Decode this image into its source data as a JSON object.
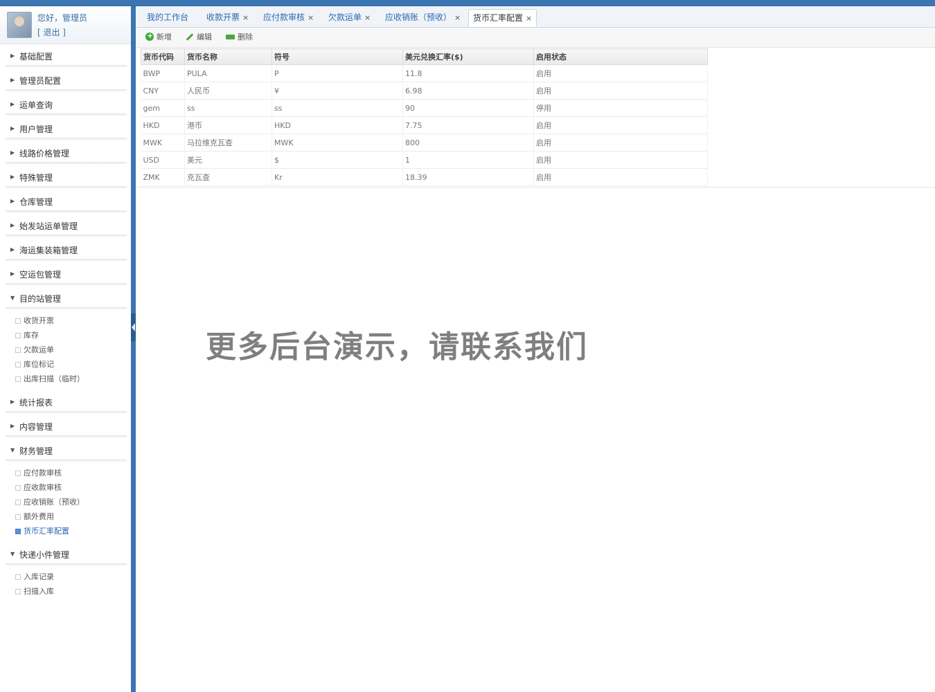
{
  "user": {
    "greeting": "您好，管理员",
    "logout": "[ 退出 ]"
  },
  "sidebar": {
    "groups": [
      {
        "label": "基础配置",
        "expanded": false
      },
      {
        "label": "管理员配置",
        "expanded": false
      },
      {
        "label": "运单查询",
        "expanded": false
      },
      {
        "label": "用户管理",
        "expanded": false
      },
      {
        "label": "线路价格管理",
        "expanded": false
      },
      {
        "label": "特殊管理",
        "expanded": false
      },
      {
        "label": "仓库管理",
        "expanded": false
      },
      {
        "label": "始发站运单管理",
        "expanded": false
      },
      {
        "label": "海运集装箱管理",
        "expanded": false
      },
      {
        "label": "空运包管理",
        "expanded": false
      },
      {
        "label": "目的站管理",
        "expanded": true,
        "items": [
          "收货开票",
          "库存",
          "欠款运单",
          "库位标记",
          "出库扫描（临时）"
        ]
      },
      {
        "label": "统计报表",
        "expanded": false
      },
      {
        "label": "内容管理",
        "expanded": false
      },
      {
        "label": "财务管理",
        "expanded": true,
        "items": [
          "应付款审核",
          "应收款审核",
          "应收销账（预收）",
          "额外费用",
          "货币汇率配置"
        ],
        "active_item": "货币汇率配置"
      },
      {
        "label": "快递小件管理",
        "expanded": true,
        "items": [
          "入库记录",
          "扫描入库"
        ]
      }
    ]
  },
  "tabs": [
    {
      "label": "我的工作台",
      "closable": false
    },
    {
      "label": "收款开票",
      "closable": true
    },
    {
      "label": "应付款审核",
      "closable": true
    },
    {
      "label": "欠款运单",
      "closable": true
    },
    {
      "label": "应收销账（预收）",
      "closable": true
    },
    {
      "label": "货币汇率配置",
      "closable": true,
      "active": true
    }
  ],
  "toolbar": {
    "add": "新增",
    "edit": "编辑",
    "delete": "删除"
  },
  "table": {
    "columns": [
      "货币代码",
      "货币名称",
      "符号",
      "美元兑换汇率($)",
      "启用状态"
    ],
    "rows": [
      [
        "BWP",
        "PULA",
        "P",
        "11.8",
        "启用"
      ],
      [
        "CNY",
        "人民币",
        "¥",
        "6.98",
        "启用"
      ],
      [
        "gem",
        "ss",
        "ss",
        "90",
        "停用"
      ],
      [
        "HKD",
        "港币",
        "HKD",
        "7.75",
        "启用"
      ],
      [
        "MWK",
        "马拉维克瓦查",
        "MWK",
        "800",
        "启用"
      ],
      [
        "USD",
        "美元",
        "$",
        "1",
        "启用"
      ],
      [
        "ZMK",
        "克瓦查",
        "Kr",
        "18.39",
        "启用"
      ]
    ]
  },
  "watermark": "更多后台演示，请联系我们",
  "colors": {
    "accent": "#3b76b3",
    "link": "#2a67b0",
    "watermark": "#7f7f7f"
  }
}
